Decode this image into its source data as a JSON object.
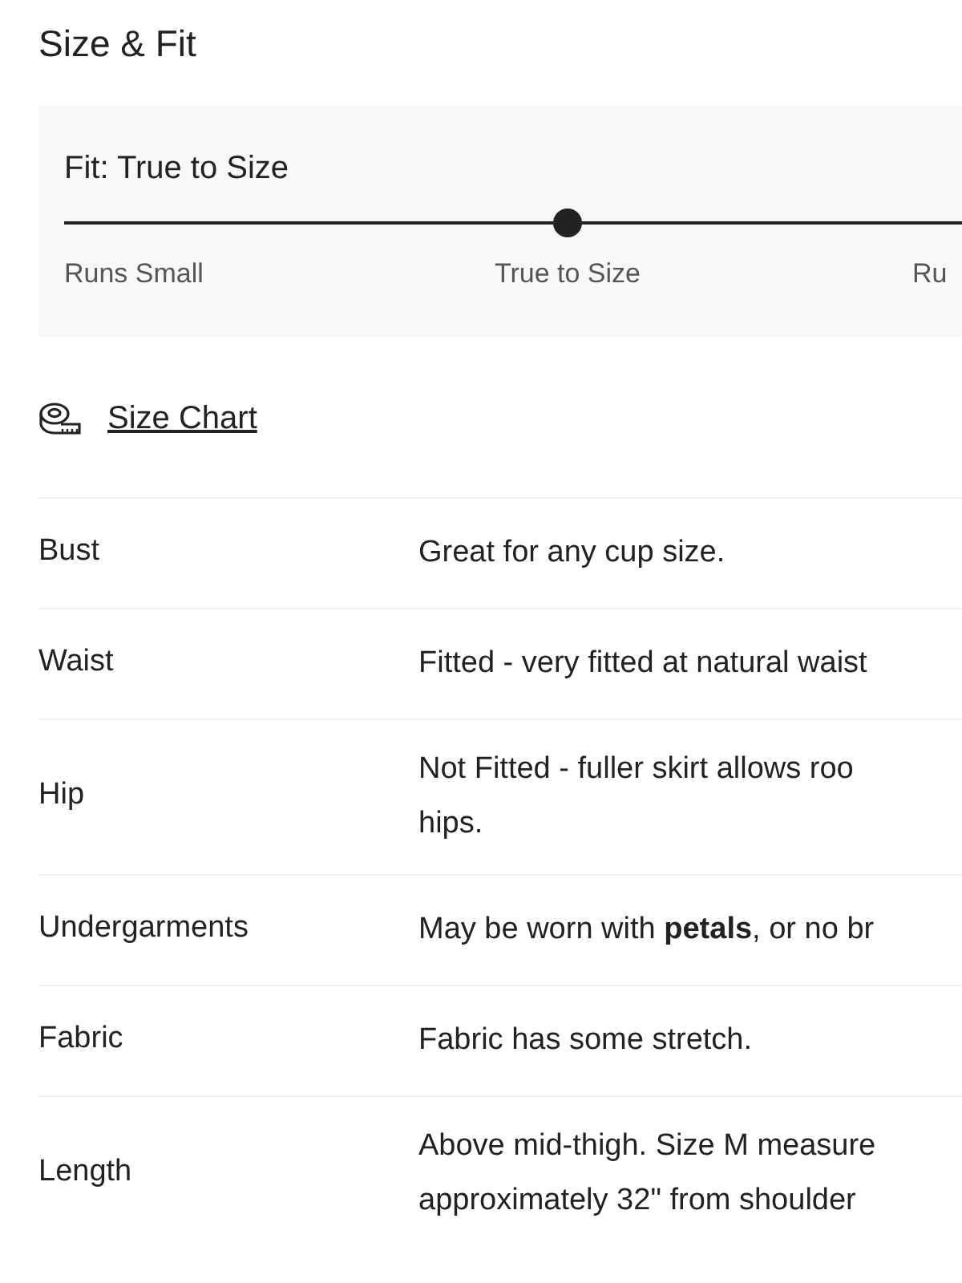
{
  "title": "Size & Fit",
  "fit": {
    "label": "Fit: True to Size",
    "level": 0.5,
    "scale": [
      "Runs Small",
      "True to Size",
      "Ru"
    ]
  },
  "size_chart_link": "Size Chart",
  "details": [
    {
      "name": "Bust",
      "lines": [
        "Great for any cup size."
      ]
    },
    {
      "name": "Waist",
      "lines": [
        "Fitted - very fitted at natural waist"
      ]
    },
    {
      "name": "Hip",
      "lines": [
        "Not Fitted - fuller skirt allows roo",
        "hips."
      ]
    },
    {
      "name": "Undergarments",
      "lines": [
        "May be worn with **petals**, or no br"
      ]
    },
    {
      "name": "Fabric",
      "lines": [
        "Fabric has some stretch."
      ]
    },
    {
      "name": "Length",
      "lines": [
        "Above mid-thigh. Size M measure",
        "approximately 32\" from shoulder"
      ]
    }
  ]
}
